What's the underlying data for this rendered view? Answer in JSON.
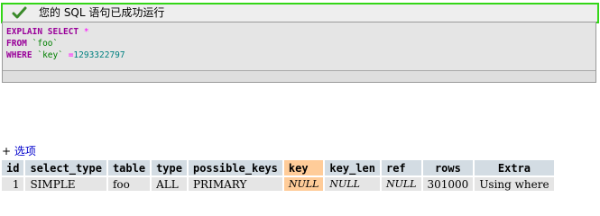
{
  "message": {
    "text": "您的 SQL 语句已成功运行",
    "status_color": "#33d617"
  },
  "sql": {
    "explain": "EXPLAIN",
    "select": "SELECT",
    "star": "*",
    "from": "FROM",
    "table": "`foo`",
    "where": "WHERE",
    "column": "`key`",
    "operator": "=",
    "value": "1293322797"
  },
  "options": {
    "plus": "+",
    "label": "选项"
  },
  "table": {
    "headers": [
      "id",
      "select_type",
      "table",
      "type",
      "possible_keys",
      "key",
      "key_len",
      "ref",
      "rows",
      "Extra"
    ],
    "rows": [
      [
        "1",
        "SIMPLE",
        "foo",
        "ALL",
        "PRIMARY",
        "NULL",
        "NULL",
        "NULL",
        "301000",
        "Using where"
      ]
    ]
  }
}
